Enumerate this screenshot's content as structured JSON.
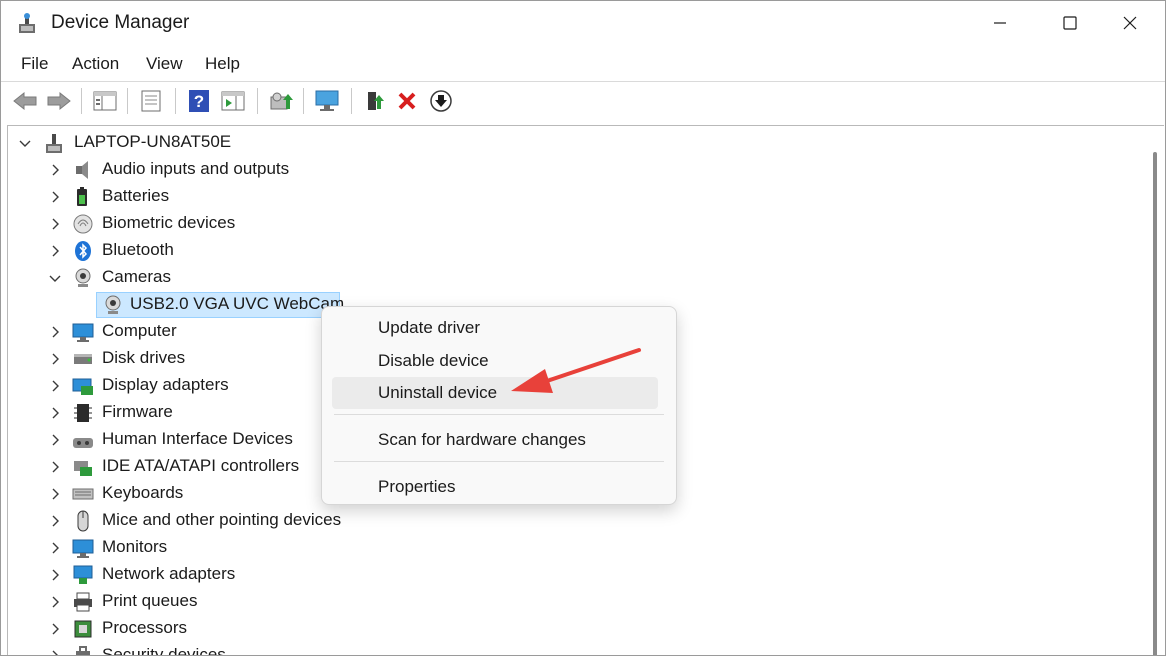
{
  "window": {
    "title": "Device Manager"
  },
  "menu": [
    "File",
    "Action",
    "View",
    "Help"
  ],
  "toolbar": {
    "buttons": [
      "back-icon",
      "forward-icon",
      "show-hide-tree-icon",
      "properties-icon",
      "help-icon",
      "action-pane-icon",
      "update-driver-icon",
      "scan-hardware-icon",
      "enable-device-icon",
      "uninstall-icon",
      "download-icon"
    ]
  },
  "tree": {
    "root": "LAPTOP-UN8AT50E",
    "categories": [
      {
        "label": "Audio inputs and outputs",
        "icon": "speaker-icon",
        "expanded": false
      },
      {
        "label": "Batteries",
        "icon": "battery-icon",
        "expanded": false
      },
      {
        "label": "Biometric devices",
        "icon": "fingerprint-icon",
        "expanded": false
      },
      {
        "label": "Bluetooth",
        "icon": "bluetooth-icon",
        "expanded": false
      },
      {
        "label": "Cameras",
        "icon": "webcam-icon",
        "expanded": true,
        "children": [
          "USB2.0 VGA UVC WebCam"
        ]
      },
      {
        "label": "Computer",
        "icon": "monitor-icon",
        "expanded": false
      },
      {
        "label": "Disk drives",
        "icon": "disk-icon",
        "expanded": false
      },
      {
        "label": "Display adapters",
        "icon": "display-adapter-icon",
        "expanded": false
      },
      {
        "label": "Firmware",
        "icon": "chip-icon",
        "expanded": false
      },
      {
        "label": "Human Interface Devices",
        "icon": "hid-icon",
        "expanded": false
      },
      {
        "label": "IDE ATA/ATAPI controllers",
        "icon": "ide-controller-icon",
        "expanded": false
      },
      {
        "label": "Keyboards",
        "icon": "keyboard-icon",
        "expanded": false
      },
      {
        "label": "Mice and other pointing devices",
        "icon": "mouse-icon",
        "expanded": false
      },
      {
        "label": "Monitors",
        "icon": "monitor-icon",
        "expanded": false
      },
      {
        "label": "Network adapters",
        "icon": "network-icon",
        "expanded": false
      },
      {
        "label": "Print queues",
        "icon": "printer-icon",
        "expanded": false
      },
      {
        "label": "Processors",
        "icon": "processor-icon",
        "expanded": false
      },
      {
        "label": "Security devices",
        "icon": "security-icon",
        "expanded": false
      }
    ]
  },
  "context_menu": {
    "items": [
      "Update driver",
      "Disable device",
      "Uninstall device",
      "Scan for hardware changes",
      "Properties"
    ],
    "highlighted": "Uninstall device"
  },
  "colors": {
    "selection": "#cce8ff",
    "annotation_arrow": "#e8413a"
  }
}
